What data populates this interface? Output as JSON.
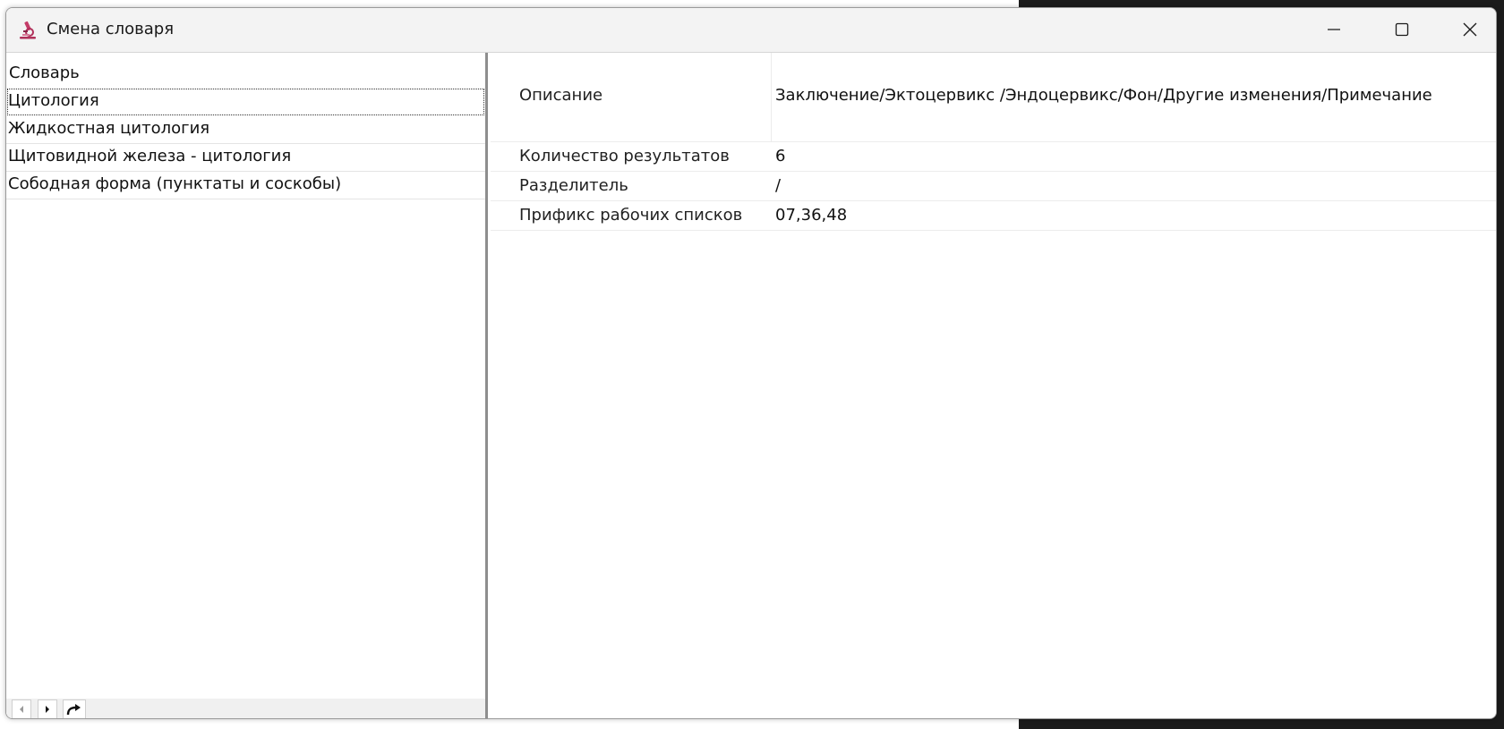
{
  "window": {
    "title": "Смена словаря",
    "icon": "microscope-icon"
  },
  "dictionary_list": {
    "header": "Словарь",
    "items": [
      {
        "label": "Цитология",
        "selected": true
      },
      {
        "label": "Жидкостная цитология",
        "selected": false
      },
      {
        "label": "Щитовидной железа - цитология",
        "selected": false
      },
      {
        "label": "Сободная форма (пунктаты и соскобы)",
        "selected": false
      }
    ]
  },
  "properties": [
    {
      "name": "Описание",
      "value": "Заключение/Эктоцервикс /Эндоцервикс/Фон/Другие изменения/Примечание"
    },
    {
      "name": "Количество результатов",
      "value": "6"
    },
    {
      "name": "Разделитель",
      "value": "/"
    },
    {
      "name": "Прификс рабочих списков",
      "value": "07,36,48"
    }
  ],
  "colors": {
    "titlebar": "#f3f3f3",
    "splitter": "#8e8e8e",
    "icon_accent": "#b0305a"
  }
}
